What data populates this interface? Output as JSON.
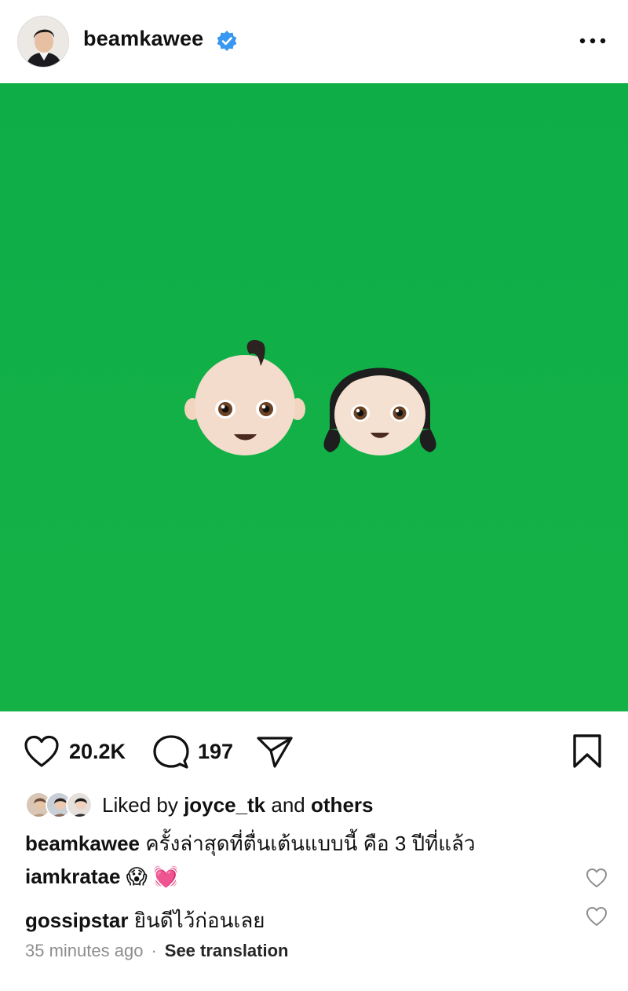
{
  "header": {
    "username": "beamkawee",
    "verified_icon": "verified-badge-icon",
    "more_icon": "more-options-icon",
    "verified_color": "#3897f0"
  },
  "post": {
    "image_background": "#12b04a",
    "emojis": [
      "👶",
      "👧"
    ]
  },
  "actions": {
    "like_icon": "heart-icon",
    "like_count": "20.2K",
    "comment_icon": "comment-bubble-icon",
    "comment_count": "197",
    "share_icon": "send-icon",
    "save_icon": "bookmark-icon"
  },
  "likes": {
    "prefix": "Liked by",
    "user": "joyce_tk",
    "connector": "and",
    "others": "others"
  },
  "caption": {
    "user": "beamkawee",
    "text": "ครั้งล่าสุดที่ตื่นเต้นแบบนี้ คือ 3 ปีที่แล้ว"
  },
  "comments": [
    {
      "user": "iamkratae",
      "text": "😱 💓"
    },
    {
      "user": "gossipstar",
      "text": "ยินดีไว้ก่อนเลย"
    }
  ],
  "meta": {
    "time": "35 minutes ago",
    "separator": "·",
    "translate": "See translation"
  }
}
